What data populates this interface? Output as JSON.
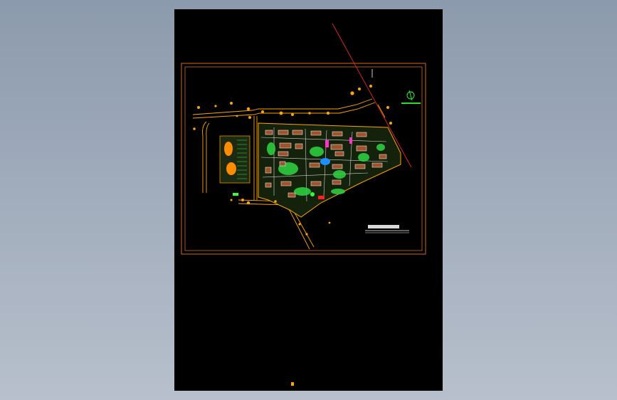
{
  "viewer": {
    "background_top": "#8c9aad",
    "background_bottom": "#b7c0cc",
    "sheet_color": "#000000"
  },
  "drawing": {
    "colors": {
      "frame": "#d2691e",
      "site_boundary": "#ffa500",
      "road": "#ffa500",
      "axis_line": "#ff2a2a",
      "north_arrow": "#33ff33",
      "buildings": "#ffffff",
      "vegetation": "#2ecc40",
      "water": "#1e90ff",
      "accent_magenta": "#ff33cc",
      "accent_red": "#ff2020"
    },
    "icons": [
      "north-arrow-icon",
      "scale-bar-icon"
    ]
  }
}
